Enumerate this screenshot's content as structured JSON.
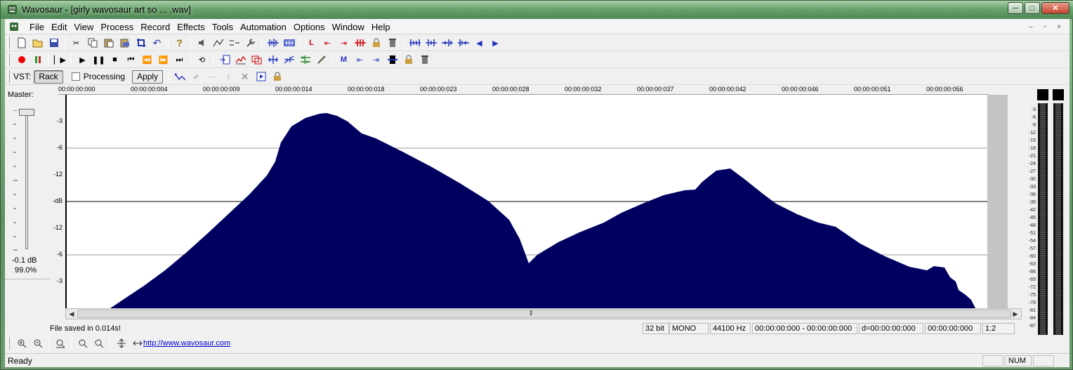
{
  "window": {
    "title": "Wavosaur - [girly wavosaur art so ... .wav]",
    "minimize": "─",
    "maximize": "□",
    "close": "✕"
  },
  "menu": {
    "items": [
      "File",
      "Edit",
      "View",
      "Process",
      "Record",
      "Effects",
      "Tools",
      "Automation",
      "Options",
      "Window",
      "Help"
    ],
    "mdi": [
      "–",
      "▫",
      "×"
    ]
  },
  "vst": {
    "label": "VST:",
    "rack": "Rack",
    "processing": "Processing",
    "apply": "Apply"
  },
  "master": {
    "label": "Master:",
    "db": "-0.1 dB",
    "percent": "99.0%"
  },
  "ruler": {
    "labels": [
      "00:00:00:000",
      "00:00:00:004",
      "00:00:00:009",
      "00:00:00:014",
      "00:00:00:018",
      "00:00:00:023",
      "00:00:00:028",
      "00:00:00:032",
      "00:00:00:037",
      "00:00:00:042",
      "00:00:00:046",
      "00:00:00:051",
      "00:00:00:056"
    ]
  },
  "db_scale": [
    "-3",
    "-6",
    "-12",
    "-dB",
    "-12",
    "-6",
    "-3"
  ],
  "vu_scale": [
    "-3",
    "-6",
    "-9",
    "-12",
    "-15",
    "-18",
    "-21",
    "-24",
    "-27",
    "-30",
    "-33",
    "-36",
    "-39",
    "-42",
    "-45",
    "-48",
    "-51",
    "-54",
    "-57",
    "-60",
    "-63",
    "-66",
    "-69",
    "-72",
    "-75",
    "-78",
    "-81",
    "-84",
    "-87"
  ],
  "info": {
    "saved": "File saved in 0.014s!",
    "bits": "32 bit",
    "channels": "MONO",
    "rate": "44100 Hz",
    "selection": "00:00:00:000 - 00:00:00:000",
    "duration": "d=00:00:00:000",
    "cursor": "00:00:00:000",
    "zoom": "1:2"
  },
  "link": "http://www.wavosaur.com",
  "status": {
    "text": "Ready",
    "num": "NUM"
  },
  "colors": {
    "waveform": "#000060",
    "titlebar": "#6aa36e"
  }
}
